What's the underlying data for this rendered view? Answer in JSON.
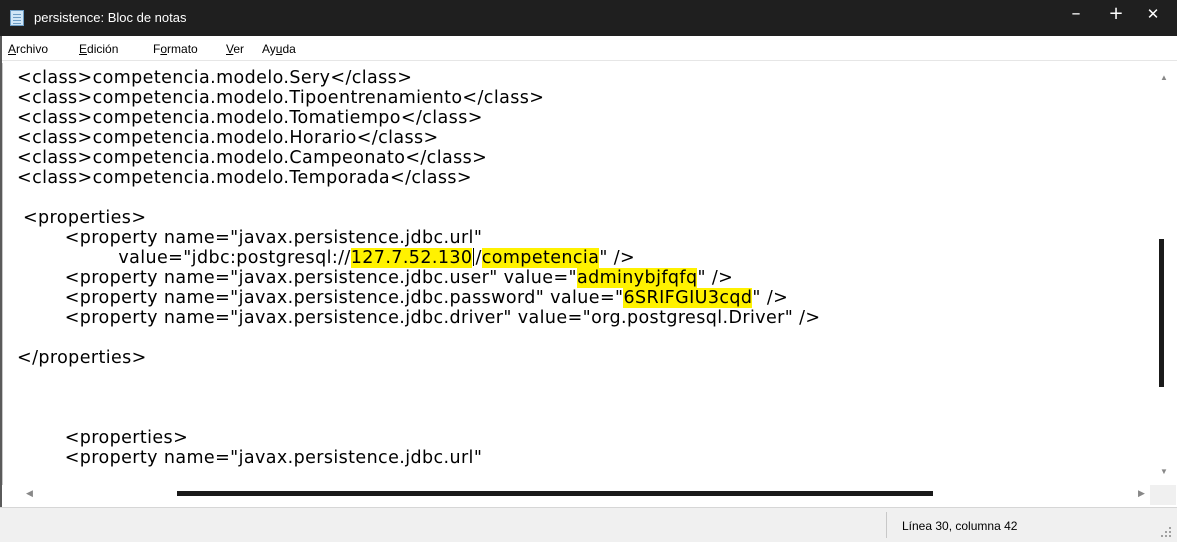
{
  "window": {
    "title": "persistence: Bloc de notas",
    "controls": {
      "minimize": "–",
      "maximize": "+",
      "close": "✕"
    }
  },
  "menu": [
    {
      "label": "Archivo",
      "accel": "A",
      "rest": "rchivo"
    },
    {
      "label": "Edición",
      "accel": "E",
      "rest": "dición"
    },
    {
      "label": "Formato",
      "pre": "F",
      "accel": "o",
      "rest": "rmato"
    },
    {
      "label": "Ver",
      "accel": "V",
      "rest": "er"
    },
    {
      "label": "Ayuda",
      "pre": "Ay",
      "accel": "u",
      "rest": "da"
    }
  ],
  "editor": {
    "lines": [
      "<class>competencia.modelo.Sery</class>",
      "<class>competencia.modelo.Tipoentrenamiento</class>",
      "<class>competencia.modelo.Tomatiempo</class>",
      "<class>competencia.modelo.Horario</class>",
      "<class>competencia.modelo.Campeonato</class>",
      "<class>competencia.modelo.Temporada</class>",
      " <properties>",
      "        <property name=\"javax.persistence.jdbc.url\"",
      "        <property name=\"javax.persistence.jdbc.password\" value=\"",
      "        <property name=\"javax.persistence.jdbc.driver\" value=\"org.postgresql.Driver\" />",
      "</properties>",
      "        <properties>",
      "        <property name=\"javax.persistence.jdbc.url\""
    ],
    "url_line": {
      "prefix": "                 value=\"jdbc:postgresql://",
      "host": "127.7.52.130",
      "slash": "/",
      "db": "competencia",
      "suffix": "\" />"
    },
    "user_line": {
      "prefix": "        <property name=\"javax.persistence.jdbc.user\" value=\"",
      "value": "adminybjfqfq",
      "suffix": "\" />"
    },
    "password_line": {
      "value": "6SRIFGIU3cqd",
      "suffix": "\" />"
    }
  },
  "status": {
    "position": "Línea 30, columna 42"
  },
  "colors": {
    "highlight": "#fff200",
    "titlebar": "#1f1f1f"
  }
}
